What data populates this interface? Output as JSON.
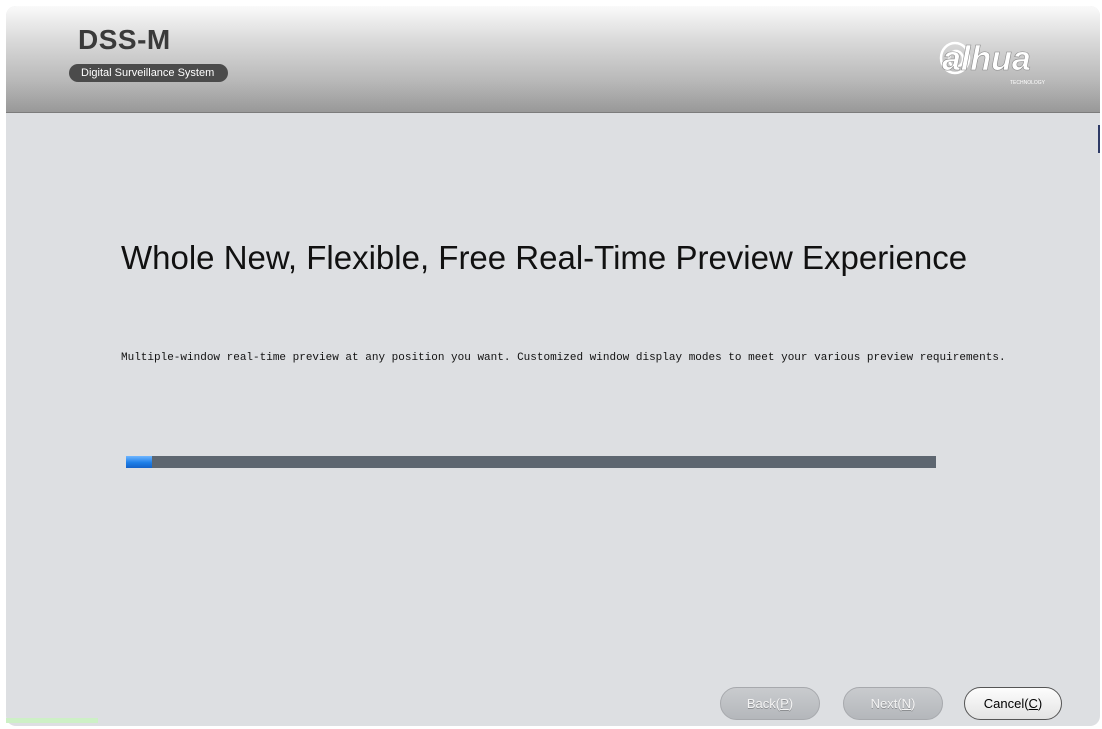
{
  "header": {
    "title": "DSS-M",
    "subtitle": "Digital Surveillance System",
    "logo_text": "alhua",
    "logo_subtext": "TECHNOLOGY",
    "logo_icon": "dahua-logo"
  },
  "content": {
    "title": "Whole New, Flexible, Free Real-Time Preview Experience",
    "description": "Multiple-window real-time preview at any position you want. Customized window display modes to meet your various preview requirements."
  },
  "progress": {
    "value_percent": 3.2
  },
  "buttons": {
    "back": {
      "label": "Back(",
      "mnemonic": "P",
      "suffix": ")",
      "enabled": false
    },
    "next": {
      "label": "Next(",
      "mnemonic": "N",
      "suffix": ")",
      "enabled": false
    },
    "cancel": {
      "label": "Cancel(",
      "mnemonic": "C",
      "suffix": ")",
      "enabled": true
    }
  },
  "colors": {
    "background": "#dddfe2",
    "progress_track": "#5d6670",
    "progress_fill": "#1e7fe8",
    "header_text": "#3a3a3a"
  }
}
